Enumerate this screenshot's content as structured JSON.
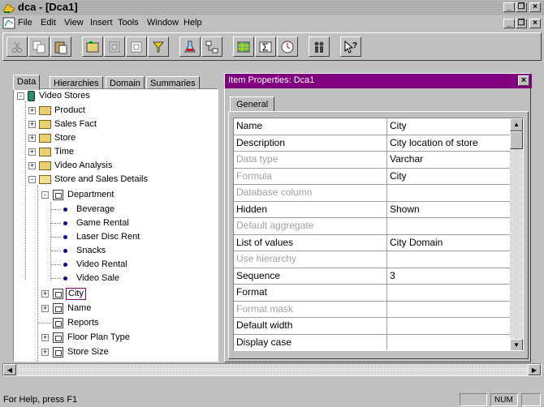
{
  "window": {
    "title": "dca - [Dca1]"
  },
  "menu": [
    "File",
    "Edit",
    "View",
    "Insert",
    "Tools",
    "Window",
    "Help"
  ],
  "toolbar": {
    "buttons": [
      "cut-icon",
      "copy-icon",
      "paste-icon",
      "new-folder-icon",
      "new-item-icon",
      "item-icon",
      "filter-icon",
      "flask-icon",
      "hierarchy-icon",
      "table-icon",
      "sum-icon",
      "clock-icon",
      "users-icon",
      "help-cursor-icon"
    ]
  },
  "left_tabs": [
    "Data",
    "Hierarchies",
    "Domain",
    "Summaries"
  ],
  "tree": {
    "root": "Video Stores",
    "folders": [
      "Product",
      "Sales Fact",
      "Store",
      "Time",
      "Video Analysis",
      "Store and Sales Details"
    ],
    "department": "Department",
    "dept_items": [
      "Beverage",
      "Game Rental",
      "Laser Disc Rent",
      "Snacks",
      "Video Rental",
      "Video Sale"
    ],
    "siblings": [
      "City",
      "Name",
      "Reports",
      "Floor Plan Type",
      "Store Size"
    ]
  },
  "properties": {
    "title": "Item Properties: Dca1",
    "tab": "General",
    "rows": [
      {
        "name": "Name",
        "value": "City",
        "enabled": true
      },
      {
        "name": "Description",
        "value": "City location of store",
        "enabled": true
      },
      {
        "name": "Data type",
        "value": "Varchar",
        "enabled": false
      },
      {
        "name": "Formula",
        "value": "City",
        "enabled": false
      },
      {
        "name": "Database column",
        "value": "",
        "enabled": false
      },
      {
        "name": "Hidden",
        "value": "Shown",
        "enabled": true
      },
      {
        "name": "Default aggregate",
        "value": "",
        "enabled": false
      },
      {
        "name": "List of values",
        "value": "City Domain",
        "enabled": true
      },
      {
        "name": "Use hierarchy",
        "value": "",
        "enabled": false
      },
      {
        "name": "Sequence",
        "value": "3",
        "enabled": true
      },
      {
        "name": "Format",
        "value": "",
        "enabled": true
      },
      {
        "name": "Format mask",
        "value": "",
        "enabled": false
      },
      {
        "name": "Default width",
        "value": "",
        "enabled": true
      },
      {
        "name": "Display case",
        "value": "",
        "enabled": true
      }
    ]
  },
  "status": {
    "text": "For Help, press F1",
    "num": "NUM"
  },
  "colors": {
    "prop_titlebar": "#800080",
    "disabled_text": "#a0a0a0"
  }
}
